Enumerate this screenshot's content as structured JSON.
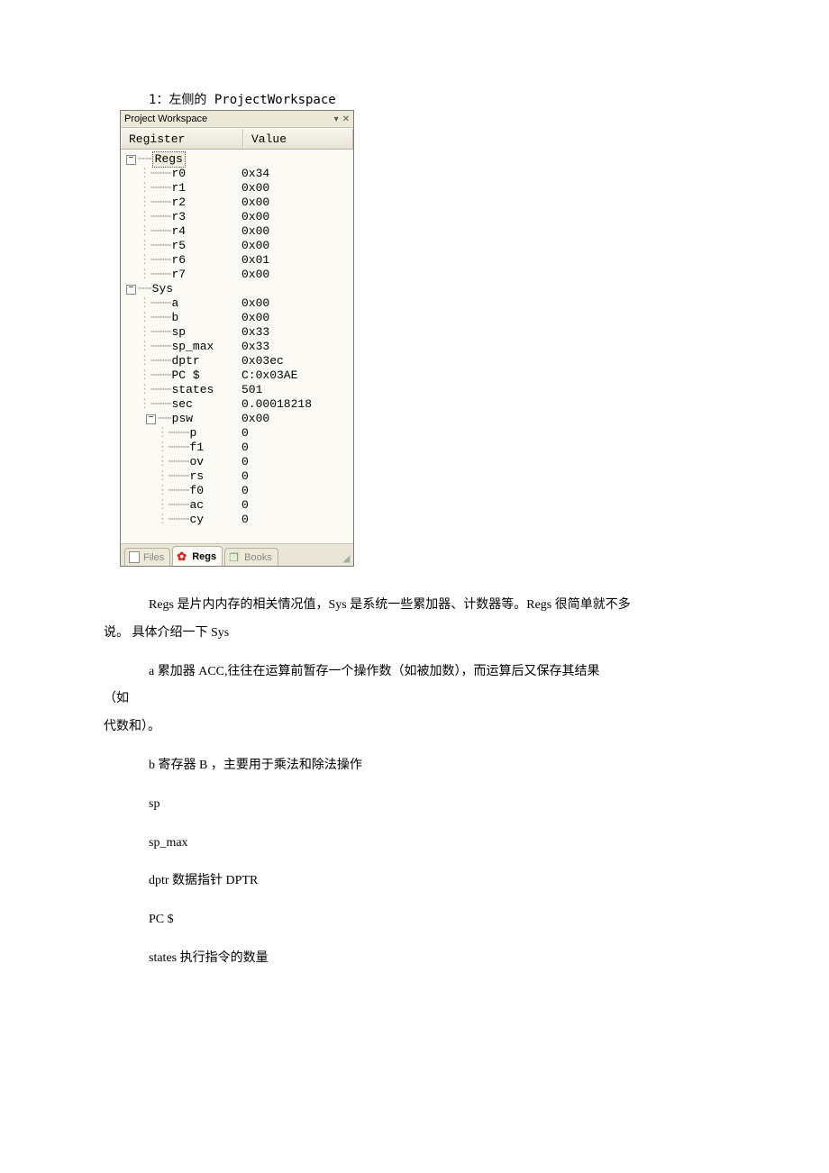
{
  "caption": "1：左侧的 ProjectWorkspace",
  "window": {
    "title": "Project Workspace",
    "headers": {
      "register": "Register",
      "value": "Value"
    },
    "groups": {
      "regs": {
        "label": "Regs",
        "rows": [
          {
            "name": "r0",
            "value": "0x34"
          },
          {
            "name": "r1",
            "value": "0x00"
          },
          {
            "name": "r2",
            "value": "0x00"
          },
          {
            "name": "r3",
            "value": "0x00"
          },
          {
            "name": "r4",
            "value": "0x00"
          },
          {
            "name": "r5",
            "value": "0x00"
          },
          {
            "name": "r6",
            "value": "0x01"
          },
          {
            "name": "r7",
            "value": "0x00"
          }
        ]
      },
      "sys": {
        "label": "Sys",
        "rows": [
          {
            "name": "a",
            "value": "0x00"
          },
          {
            "name": "b",
            "value": "0x00"
          },
          {
            "name": "sp",
            "value": "0x33"
          },
          {
            "name": "sp_max",
            "value": "0x33"
          },
          {
            "name": "dptr",
            "value": "0x03ec"
          },
          {
            "name": "PC  $",
            "value": "C:0x03AE"
          },
          {
            "name": "states",
            "value": "501"
          },
          {
            "name": "sec",
            "value": "0.00018218"
          }
        ],
        "psw": {
          "label": "psw",
          "value": "0x00",
          "flags": [
            {
              "name": "p",
              "value": "0"
            },
            {
              "name": "f1",
              "value": "0"
            },
            {
              "name": "ov",
              "value": "0"
            },
            {
              "name": "rs",
              "value": "0"
            },
            {
              "name": "f0",
              "value": "0"
            },
            {
              "name": "ac",
              "value": "0"
            },
            {
              "name": "cy",
              "value": "0"
            }
          ]
        }
      }
    },
    "tabs": {
      "files": "Files",
      "regs": "Regs",
      "books": "Books"
    }
  },
  "text": {
    "p1a": "Regs 是片内内存的相关情况值，Sys 是系统一些累加器、计数器等。Regs 很简单就不多",
    "p1b": "说。 具体介绍一下 Sys",
    "p2a": "a    累加器 ACC,往往在运算前暂存一个操作数（如被加数），而运算后又保存其结果",
    "p2b": "（如",
    "p2c": "代数和）。",
    "p3": "b 寄存器 B ，主要用于乘法和除法操作",
    "p4": "sp",
    "p5": "sp_max",
    "p6": "dptr 数据指针 DPTR",
    "p7": "PC $",
    "p8": "states 执行指令的数量"
  }
}
